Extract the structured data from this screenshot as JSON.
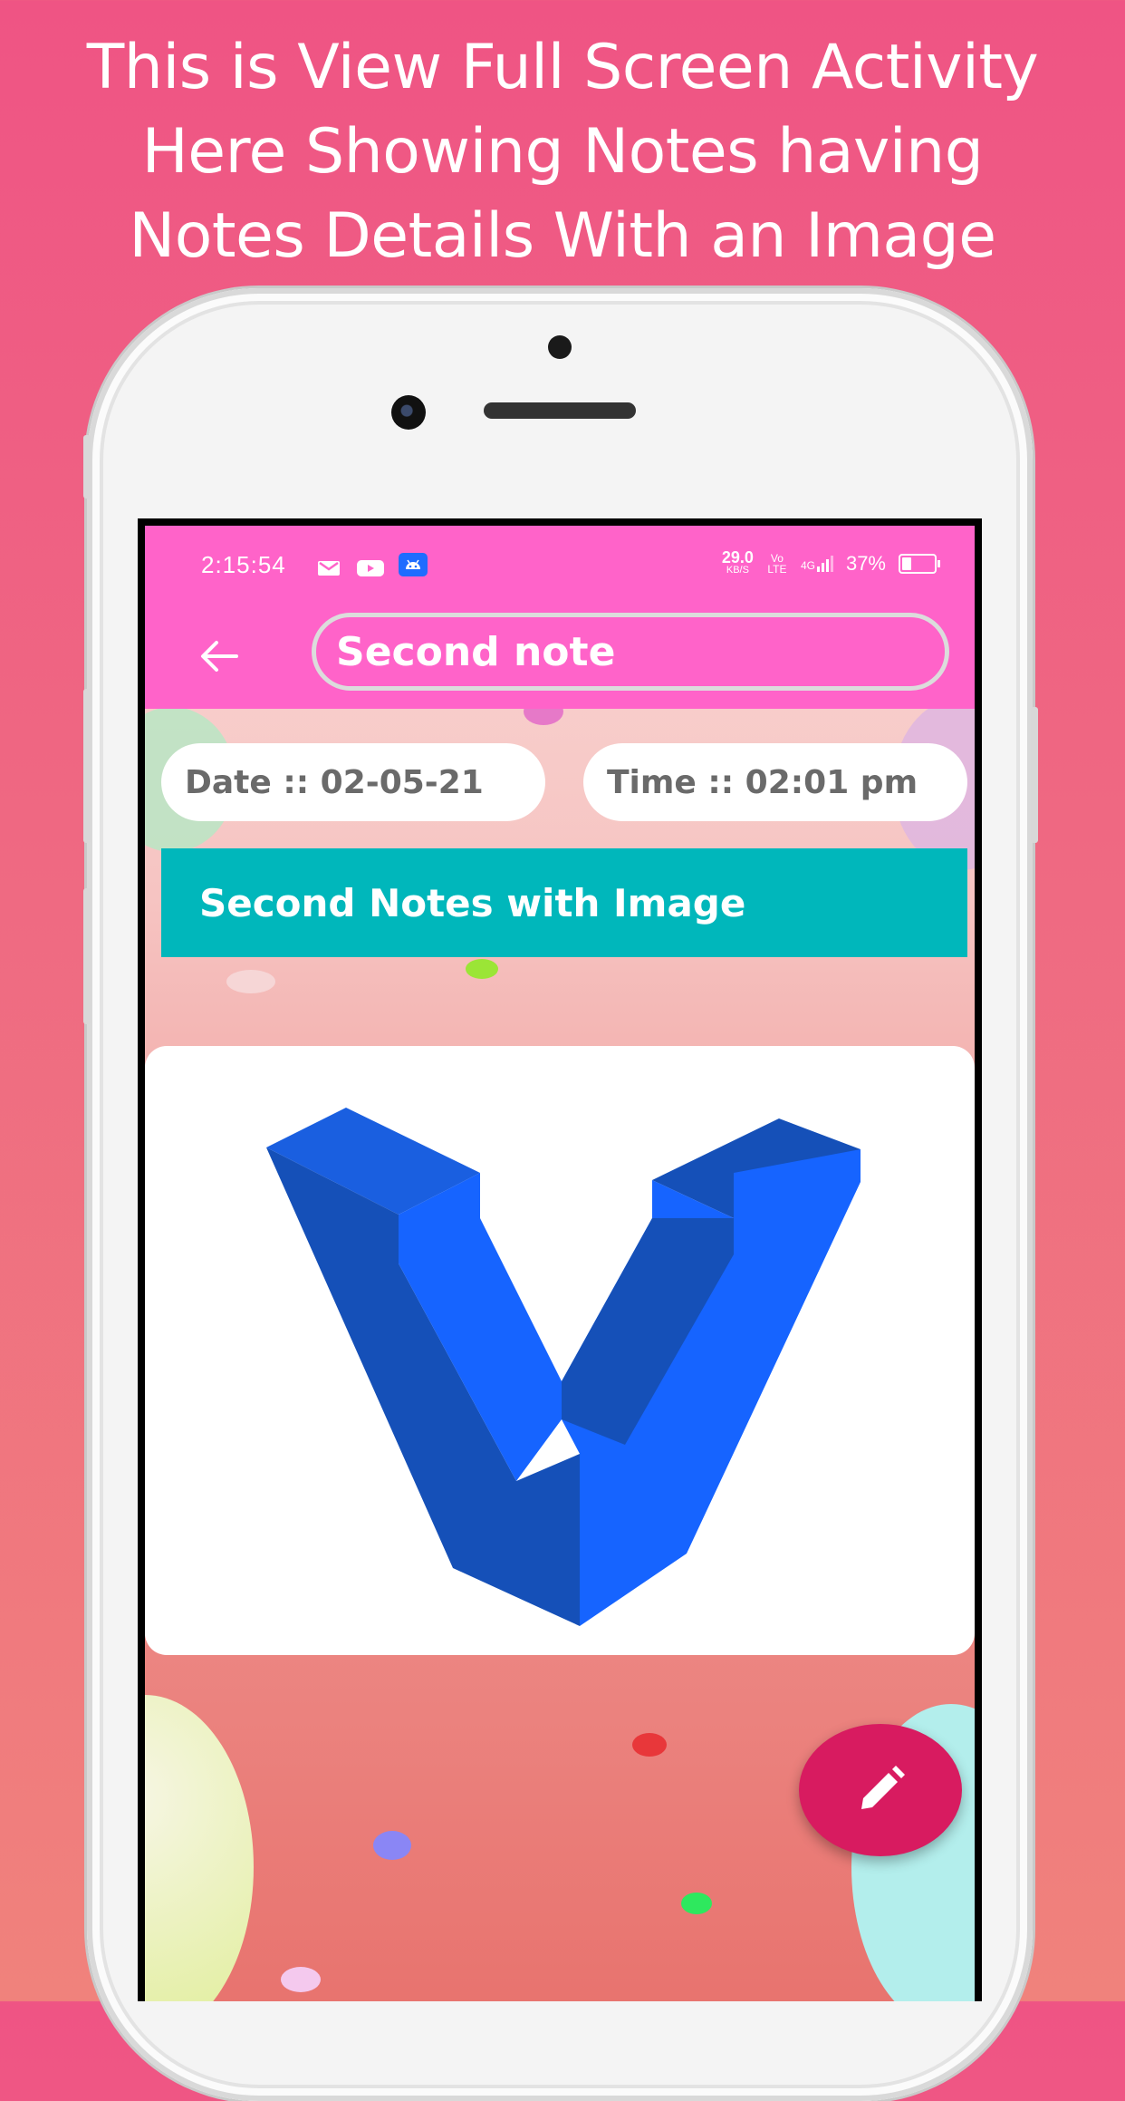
{
  "headline": {
    "line1": "This is View Full Screen Activity",
    "line2": "Here Showing Notes having",
    "line3": "Notes Details With an Image"
  },
  "status_bar": {
    "time": "2:15:54",
    "network_speed": "29.0",
    "network_unit": "KB/S",
    "volte": "Vo LTE",
    "signal": "4G",
    "battery": "37%"
  },
  "toolbar": {
    "title_value": "Second note"
  },
  "note": {
    "date_label": "Date :: 02-05-21",
    "time_label": "Time :: 02:01 pm",
    "description": "Second Notes with Image"
  },
  "icons": {
    "back": "arrow-left-icon",
    "edit": "pencil-icon",
    "gmail": "mail-icon",
    "youtube": "youtube-icon",
    "android": "android-icon"
  },
  "colors": {
    "background_top": "#ef5484",
    "app_bar": "#ff63c9",
    "banner": "#00b7bb",
    "fab": "#d81b60"
  }
}
